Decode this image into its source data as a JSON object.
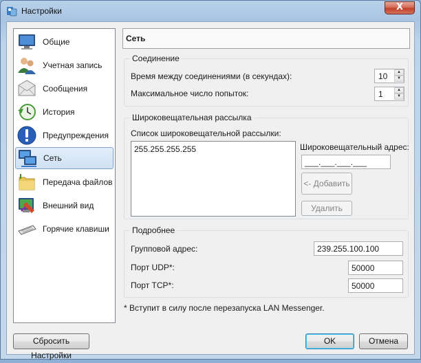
{
  "window": {
    "title": "Настройки",
    "close_symbol": "X"
  },
  "nav": {
    "items": [
      {
        "label": "Общие",
        "icon": "monitor-icon"
      },
      {
        "label": "Учетная запись",
        "icon": "users-icon"
      },
      {
        "label": "Сообщения",
        "icon": "envelope-icon"
      },
      {
        "label": "История",
        "icon": "clock-history-icon"
      },
      {
        "label": "Предупреждения",
        "icon": "exclamation-icon"
      },
      {
        "label": "Сеть",
        "icon": "network-icon"
      },
      {
        "label": "Передача файлов",
        "icon": "folder-icon"
      },
      {
        "label": "Внешний вид",
        "icon": "appearance-icon"
      },
      {
        "label": "Горячие клавиши",
        "icon": "keyboard-icon"
      }
    ],
    "selected": "Сеть"
  },
  "panel": {
    "title": "Сеть",
    "connection": {
      "title": "Соединение",
      "interval_label": "Время между соединениями (в секундах):",
      "interval_value": "10",
      "retries_label": "Максимальное число попыток:",
      "retries_value": "1"
    },
    "broadcast": {
      "title": "Широковещательная рассылка",
      "list_label": "Список широковещательной рассылки:",
      "list_items": [
        "255.255.255.255"
      ],
      "address_label": "Широковещательный адрес:",
      "address_value": "___.___.___.___",
      "add_label": "<- Добавить",
      "remove_label": "Удалить"
    },
    "advanced": {
      "title": "Подробнее",
      "multicast_label": "Групповой адрес:",
      "multicast_value": "239.255.100.100",
      "udp_label": "Порт UDP*:",
      "udp_value": "50000",
      "tcp_label": "Порт TCP*:",
      "tcp_value": "50000"
    },
    "footnote": "* Вступит в силу после перезапуска LAN Messenger."
  },
  "buttons": {
    "reset": "Сбросить Настройки",
    "ok": "OK",
    "cancel": "Отмена"
  }
}
